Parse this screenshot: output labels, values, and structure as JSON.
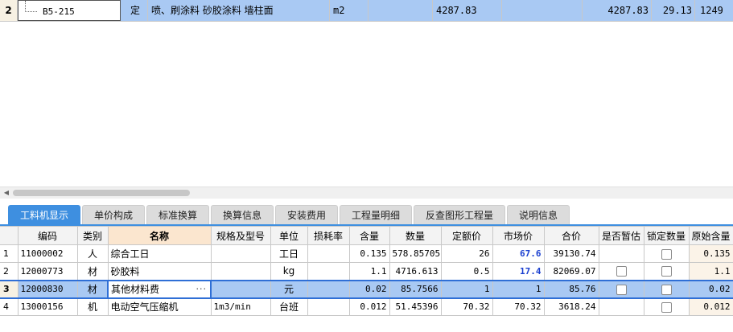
{
  "top_row": {
    "row_num": "2",
    "code": "B5-215",
    "type": "定",
    "name": "喷、刷涂料 砂胶涂料 墙柱面",
    "unit": "m2",
    "quantity": "4287.83",
    "price": "4287.83",
    "unit_price": "29.13",
    "total": "1249"
  },
  "tabs": [
    {
      "label": "工料机显示",
      "active": true
    },
    {
      "label": "单价构成",
      "active": false
    },
    {
      "label": "标准换算",
      "active": false
    },
    {
      "label": "换算信息",
      "active": false
    },
    {
      "label": "安装费用",
      "active": false
    },
    {
      "label": "工程量明细",
      "active": false
    },
    {
      "label": "反查图形工程量",
      "active": false
    },
    {
      "label": "说明信息",
      "active": false
    }
  ],
  "table": {
    "columns": [
      "编码",
      "类别",
      "名称",
      "规格及型号",
      "单位",
      "损耗率",
      "含量",
      "数量",
      "定额价",
      "市场价",
      "合价",
      "是否暂估",
      "锁定数量",
      "原始含量"
    ],
    "rows": [
      {
        "n": "1",
        "code": "11000002",
        "type": "人",
        "name": "综合工日",
        "spec": "",
        "unit": "工日",
        "loss": "",
        "content": "0.135",
        "qty": "578.85705",
        "quota": "26",
        "market": "67.6",
        "total": "39130.74",
        "has_est": false,
        "locked": true,
        "orig": "0.135",
        "market_blue": true
      },
      {
        "n": "2",
        "code": "12000773",
        "type": "材",
        "name": "砂胶料",
        "spec": "",
        "unit": "kg",
        "loss": "",
        "content": "1.1",
        "qty": "4716.613",
        "quota": "0.5",
        "market": "17.4",
        "total": "82069.07",
        "has_est": true,
        "locked": true,
        "orig": "1.1",
        "market_blue": true
      },
      {
        "n": "3",
        "code": "12000830",
        "type": "材",
        "name": "其他材料费",
        "spec": "",
        "unit": "元",
        "loss": "",
        "content": "0.02",
        "qty": "85.7566",
        "quota": "1",
        "market": "1",
        "total": "85.76",
        "has_est": true,
        "locked": true,
        "orig": "0.02",
        "market_blue": false,
        "selected": true
      },
      {
        "n": "4",
        "code": "13000156",
        "type": "机",
        "name": "电动空气压缩机",
        "spec": "1m3/min",
        "unit": "台班",
        "loss": "",
        "content": "0.012",
        "qty": "51.45396",
        "quota": "70.32",
        "market": "70.32",
        "total": "3618.24",
        "has_est": false,
        "locked": true,
        "orig": "0.012",
        "market_blue": false
      }
    ],
    "name_edit_button": "···"
  },
  "colors": {
    "accent": "#3e8fe0",
    "selection": "#a9c9f3",
    "market_price": "#1a3fd0"
  }
}
